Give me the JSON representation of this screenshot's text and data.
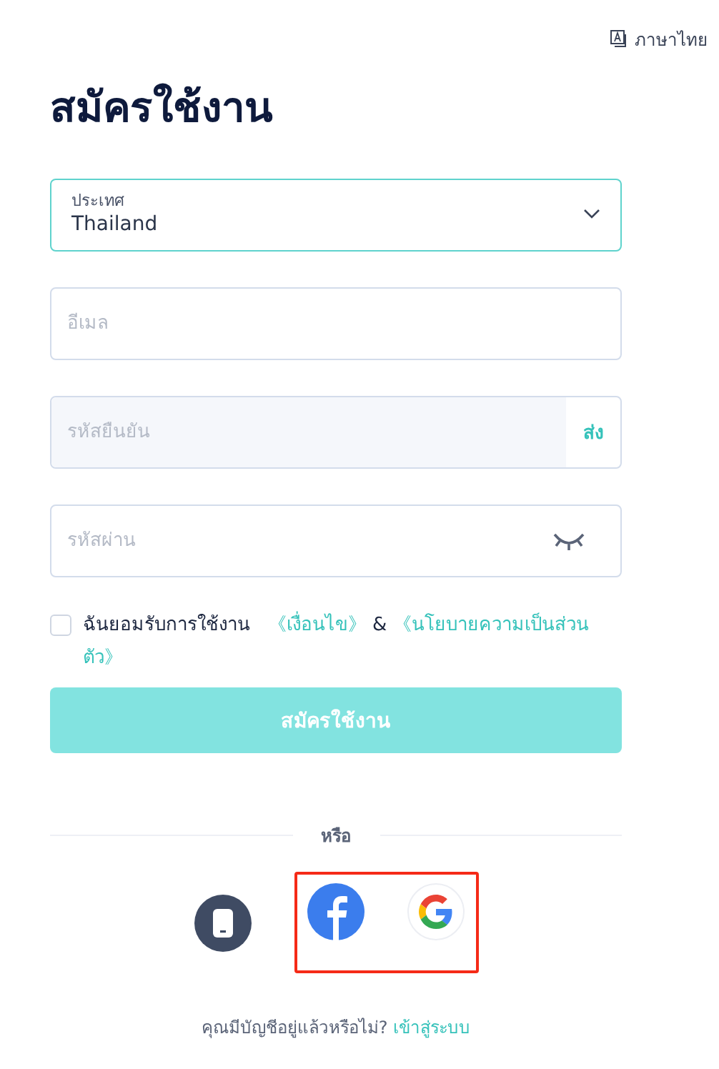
{
  "language": {
    "label": "ภาษาไทย"
  },
  "title": "สมัครใช้งาน",
  "country": {
    "label": "ประเทศ",
    "value": "Thailand"
  },
  "email": {
    "placeholder": "อีเมล"
  },
  "code": {
    "placeholder": "รหัสยืนยัน",
    "send": "ส่ง"
  },
  "password": {
    "placeholder": "รหัสผ่าน"
  },
  "terms": {
    "checked": false,
    "text": "ฉันยอมรับการใช้งาน",
    "link_1": "《เงื่อนไข》",
    "joiner": "&",
    "link_2": "《นโยบายความเป็นส่วนตัว》"
  },
  "submit": {
    "label": "สมัครใช้งาน",
    "disabled": true
  },
  "divider": "หรือ",
  "social": [
    {
      "kind": "phone",
      "highlighted": false
    },
    {
      "kind": "facebook",
      "highlighted": true
    },
    {
      "kind": "google",
      "highlighted": true
    }
  ],
  "footer": {
    "text": "คุณมีบัญชีอยู่แล้วหรือไม่?",
    "link": "เข้าสู่ระบบ"
  }
}
